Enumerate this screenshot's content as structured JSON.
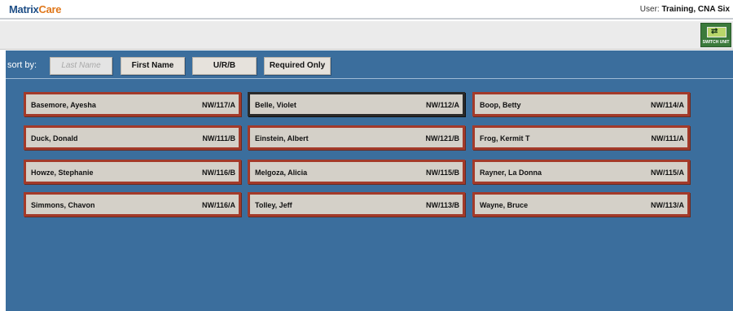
{
  "header": {
    "logo_part1": "Matrix",
    "logo_part2": "Care",
    "user_label": "User:",
    "user_name": "Training, CNA Six"
  },
  "toolbar": {
    "switch_unit_label": "SWITCH UNIT"
  },
  "sort": {
    "label": "sort by:",
    "buttons": [
      "Last Name",
      "First Name",
      "U/R/B",
      "Required Only"
    ]
  },
  "residents": [
    {
      "name": "Basemore, Ayesha",
      "room": "NW/117/A"
    },
    {
      "name": "Belle, Violet",
      "room": "NW/112/A"
    },
    {
      "name": "Boop, Betty",
      "room": "NW/114/A"
    },
    {
      "name": "Duck, Donald",
      "room": "NW/111/B"
    },
    {
      "name": "Einstein, Albert",
      "room": "NW/121/B"
    },
    {
      "name": "Frog, Kermit T",
      "room": "NW/111/A"
    },
    {
      "name": "Howze, Stephanie",
      "room": "NW/116/B"
    },
    {
      "name": "Melgoza, Alicia",
      "room": "NW/115/B"
    },
    {
      "name": "Rayner, La Donna",
      "room": "NW/115/A"
    },
    {
      "name": "Simmons, Chavon",
      "room": "NW/116/A"
    },
    {
      "name": "Tolley, Jeff",
      "room": "NW/113/B"
    },
    {
      "name": "Wayne, Bruce",
      "room": "NW/113/A"
    }
  ],
  "colors": {
    "brand_blue": "#1f4f87",
    "brand_orange": "#e0781c",
    "panel_blue": "#3b6e9d",
    "card_border": "#a33a2a"
  }
}
